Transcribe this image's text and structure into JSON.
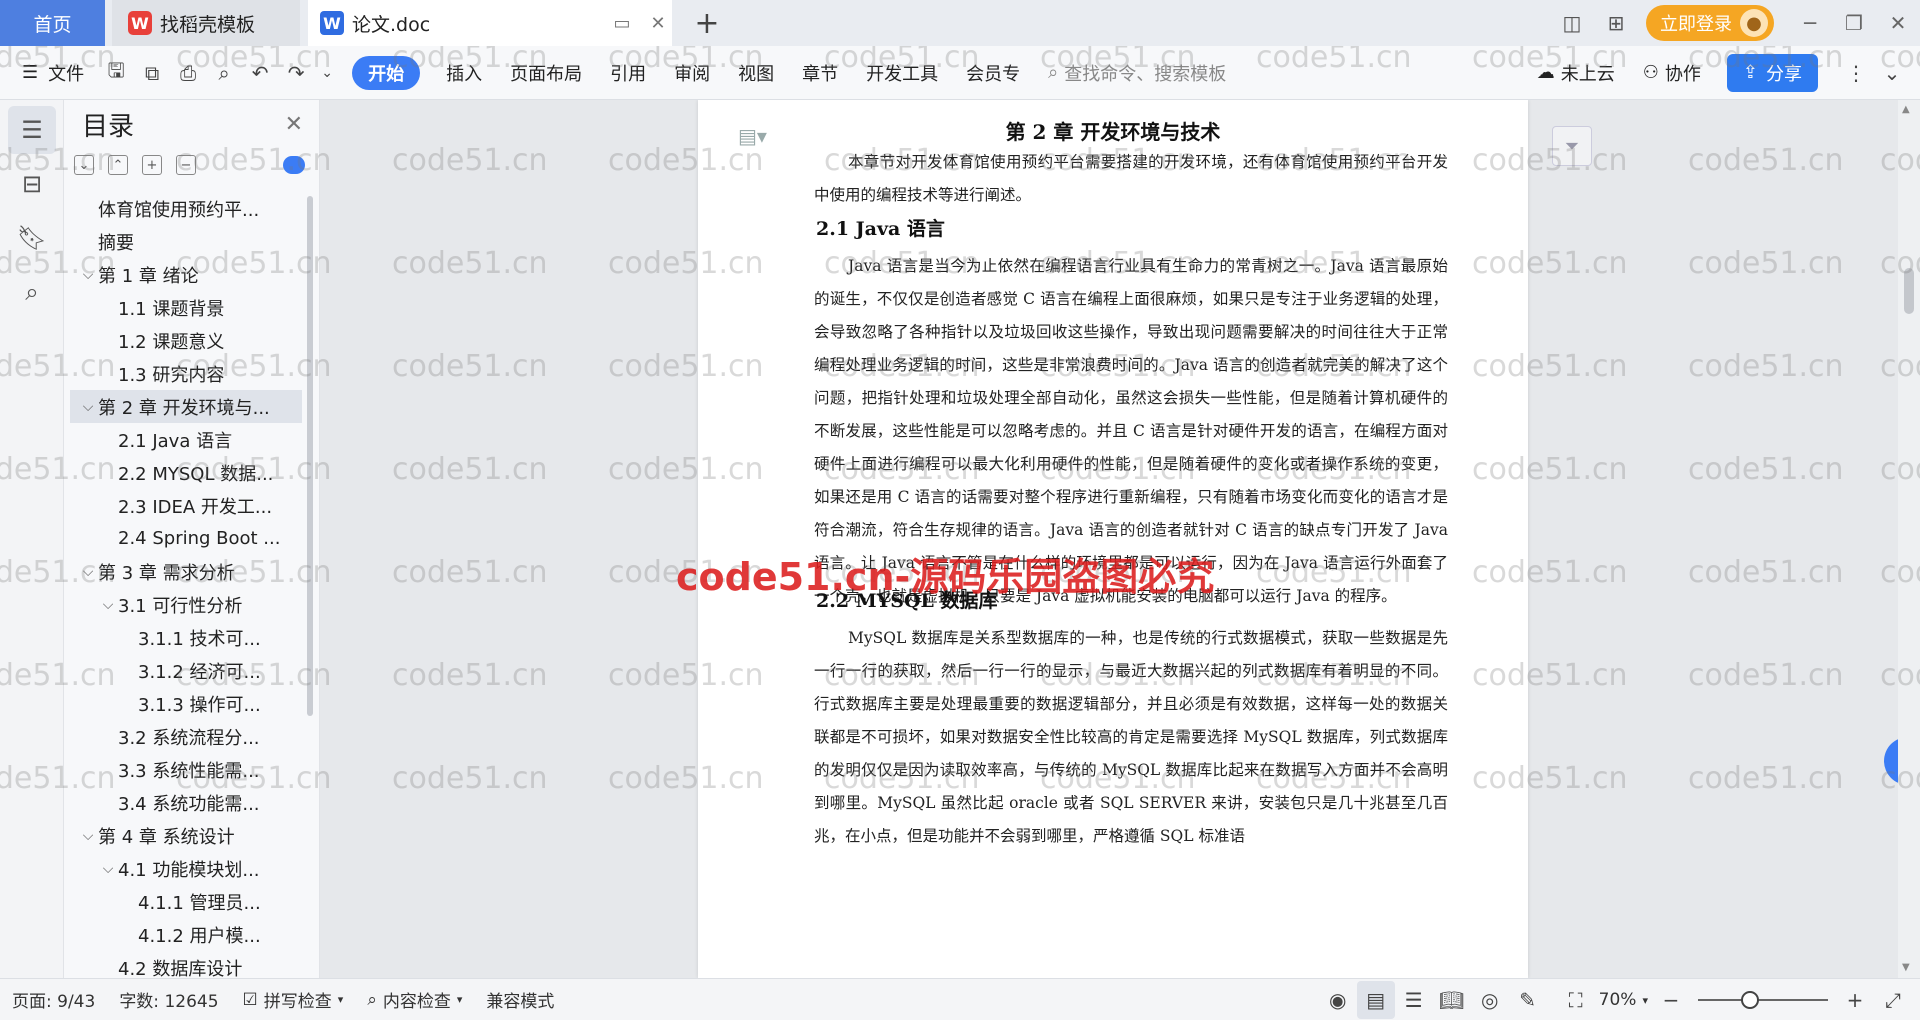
{
  "tabs": {
    "home": "首页",
    "templates": "找稻壳模板",
    "document": "论文.doc"
  },
  "topbar": {
    "login": "立即登录"
  },
  "ribbon": {
    "file": "文件",
    "tabs": [
      "开始",
      "插入",
      "页面布局",
      "引用",
      "审阅",
      "视图",
      "章节",
      "开发工具",
      "会员专"
    ],
    "search_placeholder": "查找命令、搜索模板",
    "cloud": "未上云",
    "collab": "协作",
    "share": "分享"
  },
  "toc": {
    "title": "目录",
    "items": [
      {
        "label": "体育馆使用预约平...",
        "level": 0,
        "caret": "",
        "active": false
      },
      {
        "label": "摘要",
        "level": 0,
        "caret": "",
        "active": false
      },
      {
        "label": "第 1 章  绪论",
        "level": 0,
        "caret": "⌵",
        "active": false
      },
      {
        "label": "1.1  课题背景",
        "level": 1,
        "caret": "",
        "active": false
      },
      {
        "label": "1.2  课题意义",
        "level": 1,
        "caret": "",
        "active": false
      },
      {
        "label": "1.3  研究内容",
        "level": 1,
        "caret": "",
        "active": false
      },
      {
        "label": "第 2 章  开发环境与...",
        "level": 0,
        "caret": "⌵",
        "active": true
      },
      {
        "label": "2.1 Java 语言",
        "level": 1,
        "caret": "",
        "active": false
      },
      {
        "label": "2.2 MYSQL 数据...",
        "level": 1,
        "caret": "",
        "active": false
      },
      {
        "label": "2.3 IDEA 开发工...",
        "level": 1,
        "caret": "",
        "active": false
      },
      {
        "label": "2.4 Spring Boot ...",
        "level": 1,
        "caret": "",
        "active": false
      },
      {
        "label": "第 3 章  需求分析",
        "level": 0,
        "caret": "⌵",
        "active": false
      },
      {
        "label": "3.1  可行性分析",
        "level": 1,
        "caret": "⌵",
        "active": false
      },
      {
        "label": "3.1.1  技术可...",
        "level": 2,
        "caret": "",
        "active": false
      },
      {
        "label": "3.1.2  经济可...",
        "level": 2,
        "caret": "",
        "active": false
      },
      {
        "label": "3.1.3  操作可...",
        "level": 2,
        "caret": "",
        "active": false
      },
      {
        "label": "3.2  系统流程分...",
        "level": 1,
        "caret": "",
        "active": false
      },
      {
        "label": "3.3  系统性能需...",
        "level": 1,
        "caret": "",
        "active": false
      },
      {
        "label": "3.4  系统功能需...",
        "level": 1,
        "caret": "",
        "active": false
      },
      {
        "label": "第 4 章  系统设计",
        "level": 0,
        "caret": "⌵",
        "active": false
      },
      {
        "label": "4.1  功能模块划...",
        "level": 1,
        "caret": "⌵",
        "active": false
      },
      {
        "label": "4.1.1  管理员...",
        "level": 2,
        "caret": "",
        "active": false
      },
      {
        "label": "4.1.2  用户模...",
        "level": 2,
        "caret": "",
        "active": false
      },
      {
        "label": "4.2  数据库设计",
        "level": 1,
        "caret": "",
        "active": false
      }
    ]
  },
  "document": {
    "chapter_title": "第 2 章  开发环境与技术",
    "intro": "本章节对开发体育馆使用预约平台需要搭建的开发环境，还有体育馆使用预约平台开发中使用的编程技术等进行阐述。",
    "section1_title": "2.1 Java 语言",
    "section1_body": "Java 语言是当今为止依然在编程语言行业具有生命力的常青树之一。Java 语言最原始的诞生，不仅仅是创造者感觉 C 语言在编程上面很麻烦，如果只是专注于业务逻辑的处理，会导致忽略了各种指针以及垃圾回收这些操作，导致出现问题需要解决的时间往往大于正常编程处理业务逻辑的时间，这些是非常浪费时间的。Java 语言的创造者就完美的解决了这个问题，把指针处理和垃圾处理全部自动化，虽然这会损失一些性能，但是随着计算机硬件的不断发展，这些性能是可以忽略考虑的。并且 C 语言是针对硬件开发的语言，在编程方面对硬件上面进行编程可以最大化利用硬件的性能，但是随着硬件的变化或者操作系统的变更，如果还是用 C 语言的话需要对整个程序进行重新编程，只有随着市场变化而变化的语言才是符合潮流，符合生存规律的语言。Java 语言的创造者就针对 C 语言的缺点专门开发了 Java 语言。让 Java 语言不管是在什么样的环境里都是可以运行，因为在 Java 语言运行外面套了一个壳，也就是虚拟机，只要是 Java 虚拟机能安装的电脑都可以运行 Java 的程序。",
    "section2_title": "2.2 MYSQL 数据库",
    "section2_body": "MySQL 数据库是关系型数据库的一种，也是传统的行式数据模式，获取一些数据是先一行一行的获取，然后一行一行的显示，与最近大数据兴起的列式数据库有着明显的不同。行式数据库主要是处理最重要的数据逻辑部分，并且必须是有效数据，这样每一处的数据关联都是不可损坏，如果对数据安全性比较高的肯定是需要选择 MySQL 数据库，列式数据库的发明仅仅是因为读取效率高，与传统的 MySQL 数据库比起来在数据写入方面并不会高明到哪里。MySQL 虽然比起 oracle 或者 SQL SERVER 来讲，安装包只是几十兆甚至几百兆，在小点，但是功能并不会弱到哪里，严格遵循 SQL 标准语"
  },
  "watermark": {
    "text": "code51.cn",
    "banner": "code51.cn-源码乐园盗图必究"
  },
  "statusbar": {
    "page": "页面: 9/43",
    "words": "字数: 12645",
    "spell": "拼写检查",
    "content_check": "内容检查",
    "compat": "兼容模式",
    "zoom": "70%",
    "zoom_level_fraction": 0.4
  }
}
